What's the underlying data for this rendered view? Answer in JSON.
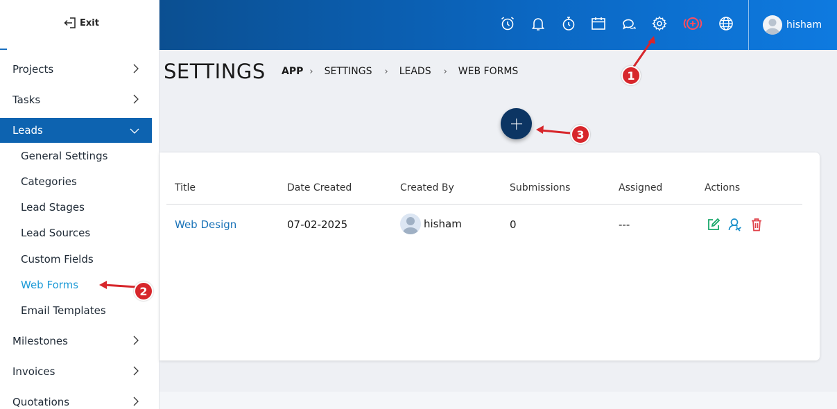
{
  "sidebar": {
    "exit_label": "Exit",
    "nav": [
      {
        "label": "Projects"
      },
      {
        "label": "Tasks"
      },
      {
        "label": "Leads"
      },
      {
        "label": "Milestones"
      },
      {
        "label": "Invoices"
      },
      {
        "label": "Quotations"
      }
    ],
    "leads_sub": [
      {
        "label": "General Settings"
      },
      {
        "label": "Categories"
      },
      {
        "label": "Lead Stages"
      },
      {
        "label": "Lead Sources"
      },
      {
        "label": "Custom Fields"
      },
      {
        "label": "Web Forms"
      },
      {
        "label": "Email Templates"
      }
    ]
  },
  "topbar": {
    "icons": [
      "alarm-clock-icon",
      "bell-icon",
      "stopwatch-icon",
      "calendar-icon",
      "chat-icon",
      "gear-icon",
      "add-circle-icon",
      "globe-icon"
    ],
    "user_name": "hisham"
  },
  "page": {
    "title": "SETTINGS",
    "breadcrumb": [
      "APP",
      "SETTINGS",
      "LEADS",
      "WEB FORMS"
    ]
  },
  "table": {
    "columns": [
      "Title",
      "Date Created",
      "Created By",
      "Submissions",
      "Assigned",
      "Actions"
    ],
    "rows": [
      {
        "title": "Web Design",
        "date_created": "07-02-2025",
        "created_by": "hisham",
        "submissions": "0",
        "assigned": "---"
      }
    ],
    "action_icons": [
      "edit-icon",
      "assign-user-icon",
      "delete-icon"
    ]
  },
  "annotations": [
    "1",
    "2",
    "3"
  ],
  "colors": {
    "topbar": "#0b67c2",
    "active_nav": "#0d63b0",
    "link": "#1a73b8",
    "current_sub": "#1e9bd7",
    "add_button": "#0c3563",
    "marker": "#d7262b",
    "edit": "#1aa86b",
    "delete": "#e0434b"
  }
}
